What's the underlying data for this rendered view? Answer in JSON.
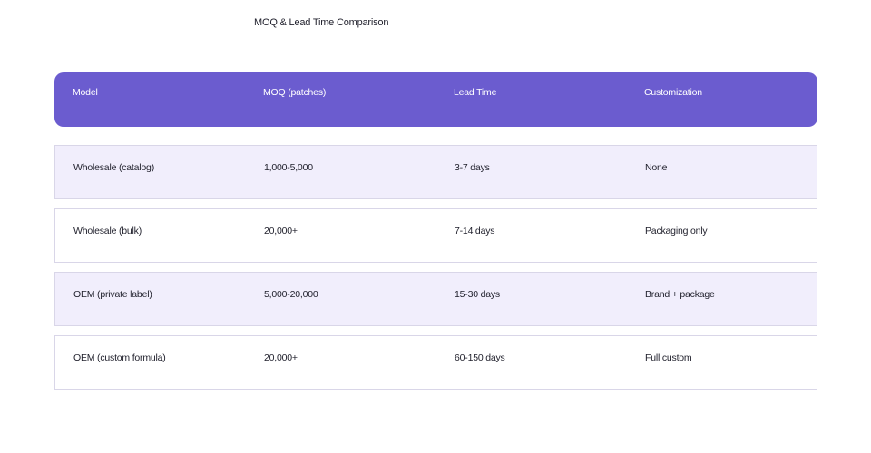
{
  "chart_data": {
    "type": "table",
    "title": "MOQ & Lead Time Comparison",
    "columns": [
      "Model",
      "MOQ (patches)",
      "Lead Time",
      "Customization"
    ],
    "rows": [
      [
        "Wholesale (catalog)",
        "1,000-5,000",
        "3-7 days",
        "None"
      ],
      [
        "Wholesale (bulk)",
        "20,000+",
        "7-14 days",
        "Packaging only"
      ],
      [
        "OEM (private label)",
        "5,000-20,000",
        "15-30 days",
        "Brand + package"
      ],
      [
        "OEM (custom formula)",
        "20,000+",
        "60-150 days",
        "Full custom"
      ]
    ]
  },
  "colors": {
    "header_bg": "#6b5ccf",
    "alt_row_bg": "#f1eefc",
    "row_border": "#d9d6e8"
  }
}
